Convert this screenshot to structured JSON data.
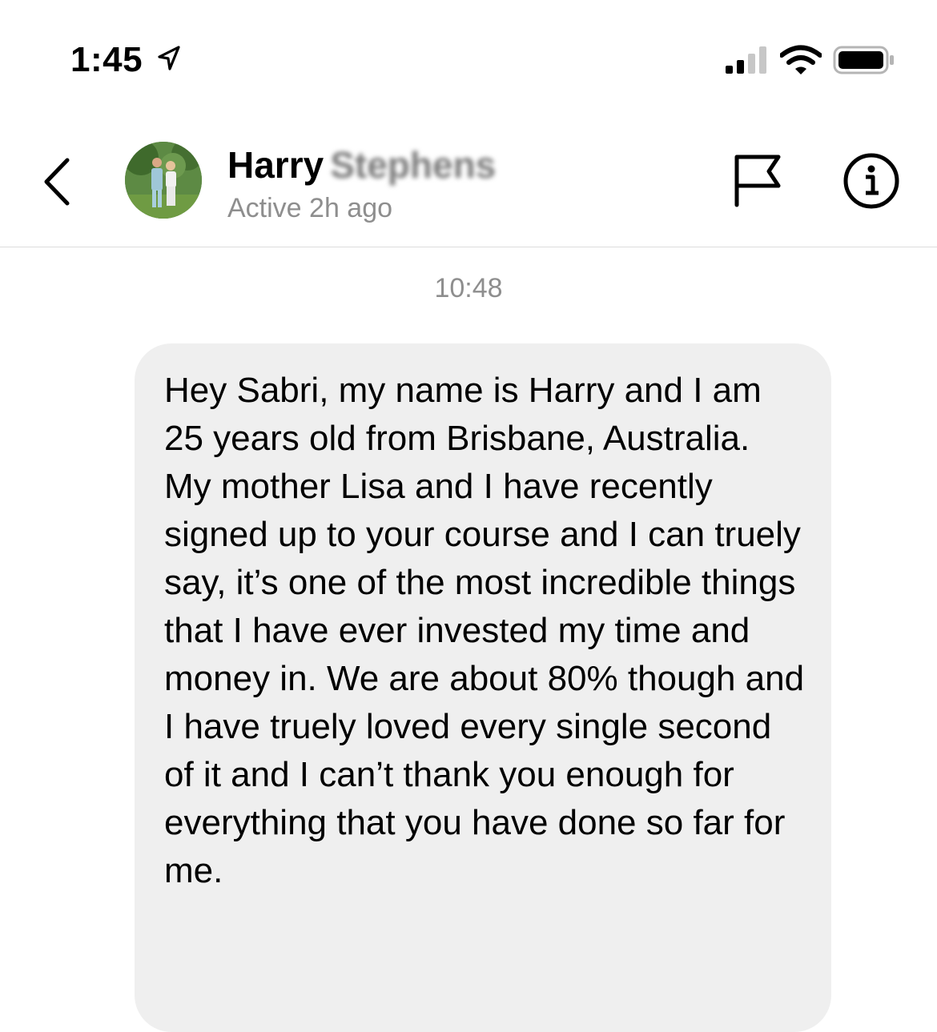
{
  "status_bar": {
    "time": "1:45",
    "icons": [
      "location-arrow-icon",
      "cellular-signal-icon",
      "wifi-icon",
      "battery-icon"
    ]
  },
  "header": {
    "first_name": "Harry",
    "surname_blurred": "Stephens",
    "active_status": "Active 2h ago",
    "icons": [
      "back-chevron-icon",
      "flag-icon",
      "info-icon"
    ]
  },
  "conversation": {
    "timestamp": "10:48",
    "messages": [
      {
        "text": "Hey Sabri, my name is Harry and I am 25 years old from Brisbane, Australia. My mother Lisa and I have recently signed up to your course and I can truely say, it’s one of the most incredible things that I have ever invested my time and money in. We are about 80% though and I have truely loved every single second of it and I can’t thank you enough for everything that you have done so far for me."
      }
    ]
  },
  "colors": {
    "bubble_background": "#efefef",
    "secondary_text": "#8e8e8e",
    "divider": "#dcdcdc"
  }
}
